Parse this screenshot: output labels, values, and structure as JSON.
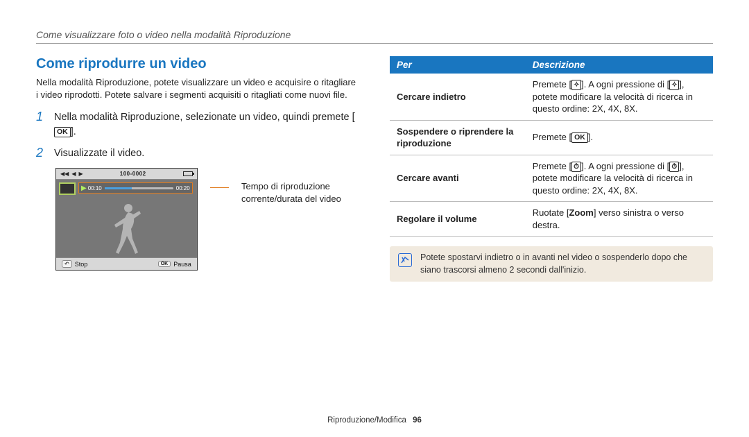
{
  "breadcrumb": "Come visualizzare foto o video nella modalità Riproduzione",
  "left": {
    "title": "Come riprodurre un video",
    "intro": "Nella modalità Riproduzione, potete visualizzare un video e acquisire o ritagliare i video riprodotti. Potete salvare i segmenti acquisiti o ritagliati come nuovi file.",
    "step1_num": "1",
    "step1_text": "Nella modalità Riproduzione, selezionate un video, quindi premete [",
    "step1_icon": "OK",
    "step1_tail": "].",
    "step2_num": "2",
    "step2_text": "Visualizzate il video.",
    "shot": {
      "top_icons_label": "◄ ◄ ►",
      "file_counter": "100-0002",
      "time_current": "00:10",
      "time_total": "00:20",
      "bottom_back_icon": "↶",
      "bottom_stop": "Stop",
      "bottom_ok": "OK",
      "bottom_pausa": "Pausa"
    },
    "callout": "Tempo di riproduzione corrente/durata del video"
  },
  "table": {
    "head_per": "Per",
    "head_descr": "Descrizione",
    "rows": [
      {
        "per": "Cercare indietro",
        "descr_pre": "Premete [",
        "icon": "✧",
        "descr_mid": "]. A ogni pressione di [",
        "descr_post": "], potete modificare la velocità di ricerca in questo ordine: 2X, 4X, 8X."
      },
      {
        "per": "Sospendere o riprendere la riproduzione",
        "descr_pre": "Premete [",
        "icon": "OK",
        "descr_post": "]."
      },
      {
        "per": "Cercare avanti",
        "descr_pre": "Premete [",
        "icon": "⏱",
        "descr_mid": "]. A ogni pressione di [",
        "descr_post": "], potete modificare la velocità di ricerca in questo ordine: 2X, 4X, 8X."
      },
      {
        "per": "Regolare il volume",
        "descr_full": "Ruotate [Zoom] verso sinistra o verso destra."
      }
    ]
  },
  "note": "Potete spostarvi indietro o in avanti nel video o sospenderlo dopo che siano trascorsi almeno 2 secondi dall'inizio.",
  "footer": {
    "section": "Riproduzione/Modifica",
    "page": "96"
  }
}
